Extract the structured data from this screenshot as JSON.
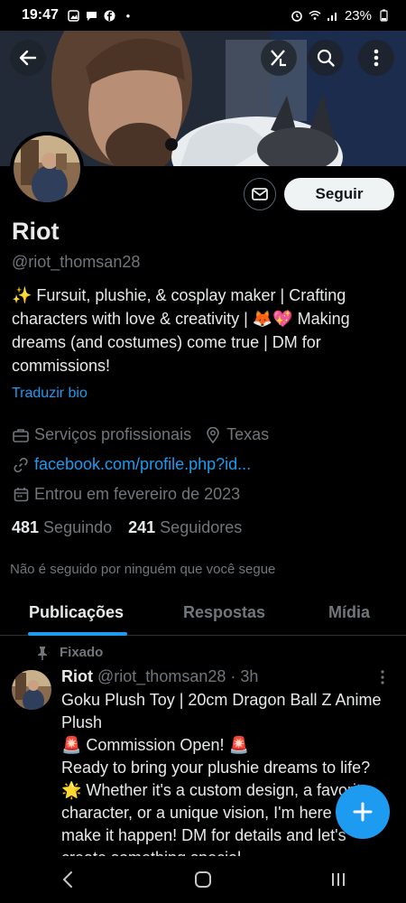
{
  "status_bar": {
    "time": "19:47",
    "battery": "23%"
  },
  "banner": {
    "buttons": [
      "back-icon",
      "grok-icon",
      "search-icon",
      "more-vertical-icon"
    ]
  },
  "profile": {
    "name": "Riot",
    "handle": "@riot_thomsan28",
    "bio": "✨ Fursuit, plushie, & cosplay maker | Crafting characters with love & creativity | 🦊💖 Making dreams (and costumes) come true | DM for commissions!",
    "translate_bio": "Traduzir bio",
    "category": "Serviços profissionais",
    "location": "Texas",
    "website": "facebook.com/profile.php?id...",
    "joined": "Entrou em fevereiro de 2023",
    "following_count": "481",
    "following_label": "Seguindo",
    "followers_count": "241",
    "followers_label": "Seguidores",
    "not_followed_text": "Não é seguido por ninguém que você segue",
    "follow_button": "Seguir"
  },
  "tabs": [
    "Publicações",
    "Respostas",
    "Mídia"
  ],
  "active_tab": "Publicações",
  "pinned_post": {
    "pinned_label": "Fixado",
    "author_name": "Riot",
    "author_handle": "@riot_thomsan28",
    "time": "· 3h",
    "lines": [
      "Goku Plush Toy | 20cm Dragon Ball Z Anime Plush",
      "🚨 Commission Open! 🚨",
      "Ready to bring your plushie dreams to life? 🌟 Whether it's a custom design, a favorite character, or a unique vision, I'm here to make it happen! DM for details and let's create something special."
    ]
  },
  "colors": {
    "accent": "#1d9bf0",
    "background": "#000000",
    "text_primary": "#e7e9ea",
    "text_secondary": "#71767b"
  }
}
